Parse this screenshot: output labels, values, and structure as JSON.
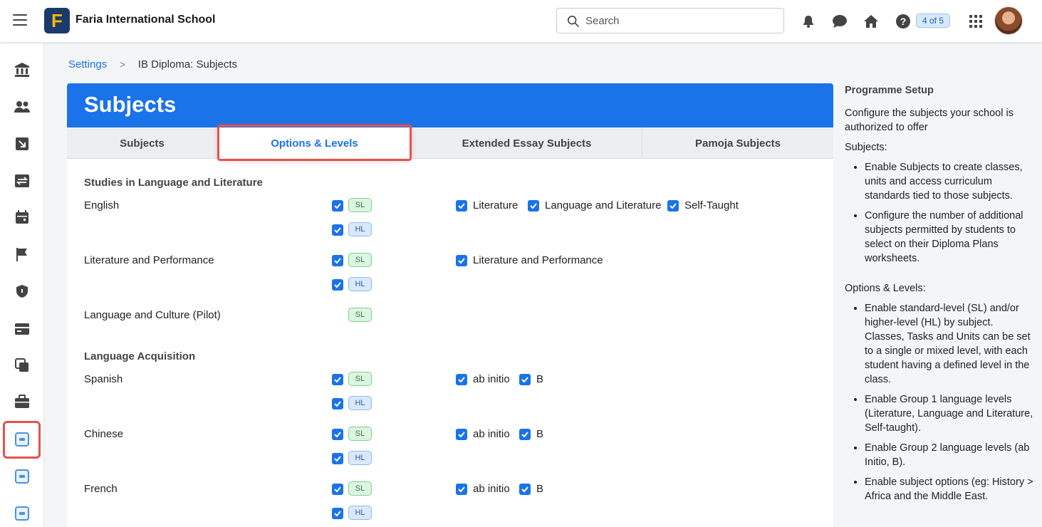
{
  "header": {
    "school_name": "Faria International School",
    "logo_letter": "F",
    "search_placeholder": "Search",
    "pager": "4 of 5"
  },
  "breadcrumb": {
    "parent": "Settings",
    "separator": ">",
    "current": "IB Diploma: Subjects"
  },
  "card": {
    "title": "Subjects",
    "tabs": [
      {
        "label": "Subjects"
      },
      {
        "label": "Options & Levels"
      },
      {
        "label": "Extended Essay Subjects"
      },
      {
        "label": "Pamoja Subjects"
      }
    ],
    "active_tab": "Options & Levels"
  },
  "groups": [
    {
      "title": "Studies in Language and Literature",
      "subjects": [
        {
          "name": "English",
          "levels": [
            {
              "code": "SL",
              "checked": true
            },
            {
              "code": "HL",
              "checked": true
            }
          ],
          "options": [
            "Literature",
            "Language and Literature",
            "Self-Taught"
          ]
        },
        {
          "name": "Literature and Performance",
          "levels": [
            {
              "code": "SL",
              "checked": true
            },
            {
              "code": "HL",
              "checked": true
            }
          ],
          "options": [
            "Literature and Performance"
          ]
        },
        {
          "name": "Language and Culture (Pilot)",
          "levels": [
            {
              "code": "SL",
              "checked": false
            }
          ],
          "options": []
        }
      ]
    },
    {
      "title": "Language Acquisition",
      "subjects": [
        {
          "name": "Spanish",
          "levels": [
            {
              "code": "SL",
              "checked": true
            },
            {
              "code": "HL",
              "checked": true
            }
          ],
          "options": [
            "ab initio",
            "B"
          ]
        },
        {
          "name": "Chinese",
          "levels": [
            {
              "code": "SL",
              "checked": true
            },
            {
              "code": "HL",
              "checked": true
            }
          ],
          "options": [
            "ab initio",
            "B"
          ]
        },
        {
          "name": "French",
          "levels": [
            {
              "code": "SL",
              "checked": true
            },
            {
              "code": "HL",
              "checked": true
            }
          ],
          "options": [
            "ab initio",
            "B"
          ]
        }
      ]
    }
  ],
  "help": {
    "heading": "Programme Setup",
    "intro": "Configure the subjects your school is authorized to offer",
    "subjects_heading": "Subjects:",
    "subjects_items": [
      "Enable Subjects to create classes, units and access curriculum standards tied to those subjects.",
      "Configure the number of additional subjects permitted by students to select on their Diploma Plans worksheets."
    ],
    "options_heading": "Options & Levels:",
    "options_items": [
      "Enable standard-level (SL) and/or higher-level (HL) by subject. Classes, Tasks and Units can be set to a single or mixed level, with each student having a defined level in the class.",
      "Enable Group 1 language levels (Literature, Language and Literature, Self-taught).",
      "Enable Group 2 language levels (ab Initio, B).",
      "Enable subject options (eg: History > Africa and the Middle East."
    ]
  },
  "colors": {
    "brand_blue": "#1a73e8",
    "highlight_red": "#e5534b",
    "sl_green": "#dcf5e1",
    "hl_blue": "#d9e9fb"
  }
}
